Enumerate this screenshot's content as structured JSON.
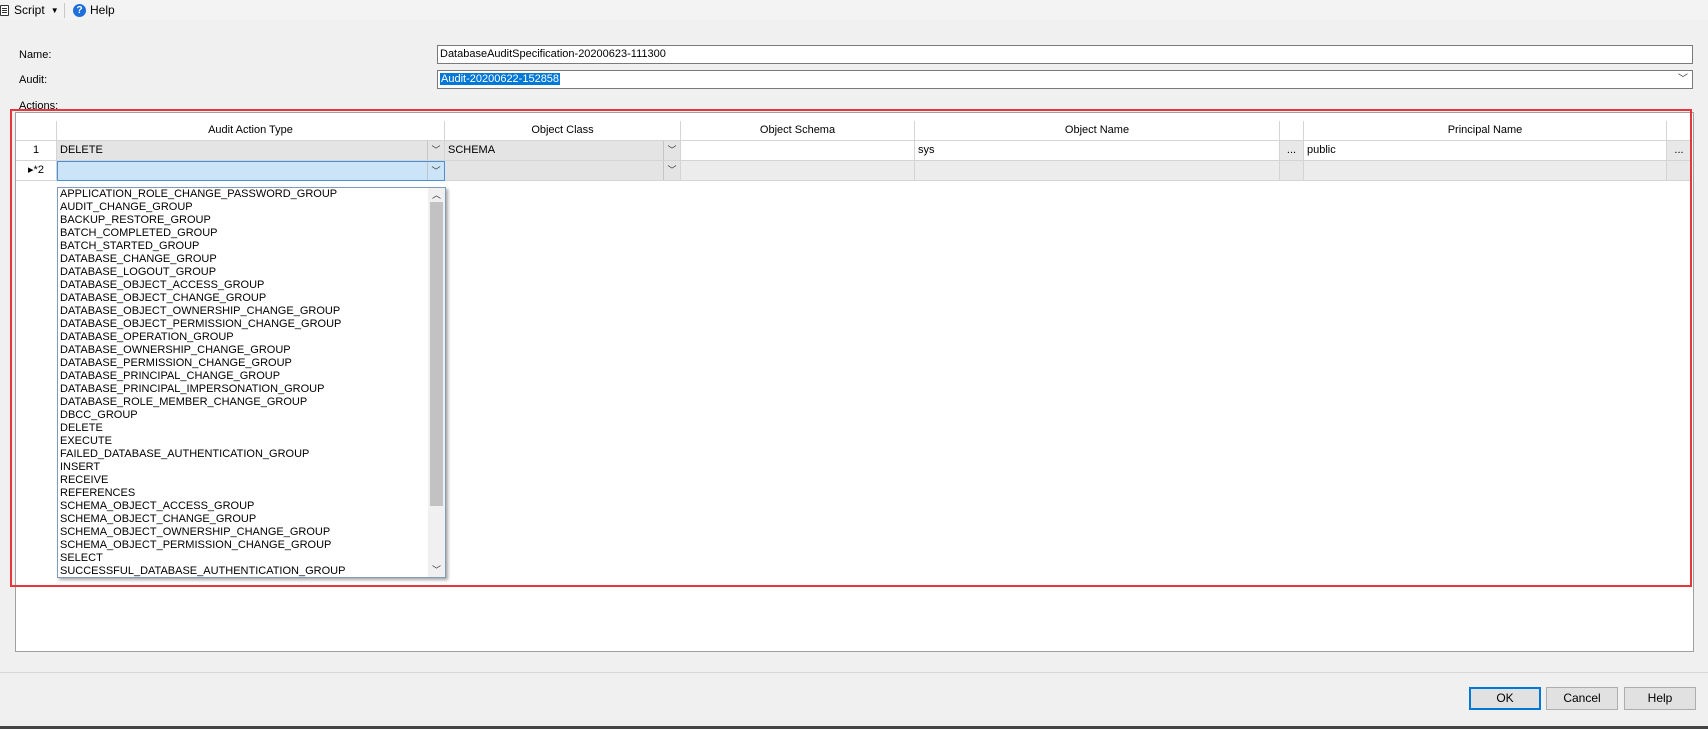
{
  "toolbar": {
    "script_label": "Script",
    "help_label": "Help"
  },
  "form": {
    "name_label": "Name:",
    "name_value": "DatabaseAuditSpecification-20200623-111300",
    "audit_label": "Audit:",
    "audit_value": "Audit-20200622-152858",
    "actions_label": "Actions:"
  },
  "grid": {
    "columns": [
      "Audit Action Type",
      "Object Class",
      "Object Schema",
      "Object Name",
      "Principal Name"
    ],
    "rows": [
      {
        "num": "1",
        "action": "DELETE",
        "object_class": "SCHEMA",
        "schema": "",
        "object_name": "sys",
        "principal": "public"
      },
      {
        "num": "2",
        "indicator": "▸*",
        "action": "",
        "object_class": "",
        "schema": "",
        "object_name": "",
        "principal": ""
      }
    ],
    "ellipsis": "..."
  },
  "dropdown": {
    "options": [
      "APPLICATION_ROLE_CHANGE_PASSWORD_GROUP",
      "AUDIT_CHANGE_GROUP",
      "BACKUP_RESTORE_GROUP",
      "BATCH_COMPLETED_GROUP",
      "BATCH_STARTED_GROUP",
      "DATABASE_CHANGE_GROUP",
      "DATABASE_LOGOUT_GROUP",
      "DATABASE_OBJECT_ACCESS_GROUP",
      "DATABASE_OBJECT_CHANGE_GROUP",
      "DATABASE_OBJECT_OWNERSHIP_CHANGE_GROUP",
      "DATABASE_OBJECT_PERMISSION_CHANGE_GROUP",
      "DATABASE_OPERATION_GROUP",
      "DATABASE_OWNERSHIP_CHANGE_GROUP",
      "DATABASE_PERMISSION_CHANGE_GROUP",
      "DATABASE_PRINCIPAL_CHANGE_GROUP",
      "DATABASE_PRINCIPAL_IMPERSONATION_GROUP",
      "DATABASE_ROLE_MEMBER_CHANGE_GROUP",
      "DBCC_GROUP",
      "DELETE",
      "EXECUTE",
      "FAILED_DATABASE_AUTHENTICATION_GROUP",
      "INSERT",
      "RECEIVE",
      "REFERENCES",
      "SCHEMA_OBJECT_ACCESS_GROUP",
      "SCHEMA_OBJECT_CHANGE_GROUP",
      "SCHEMA_OBJECT_OWNERSHIP_CHANGE_GROUP",
      "SCHEMA_OBJECT_PERMISSION_CHANGE_GROUP",
      "SELECT",
      "SUCCESSFUL_DATABASE_AUTHENTICATION_GROUP"
    ]
  },
  "buttons": {
    "ok": "OK",
    "cancel": "Cancel",
    "help": "Help"
  },
  "colors": {
    "highlight_border": "#e8353b",
    "selection": "#0078d7",
    "active_cell": "#cce4f7"
  }
}
